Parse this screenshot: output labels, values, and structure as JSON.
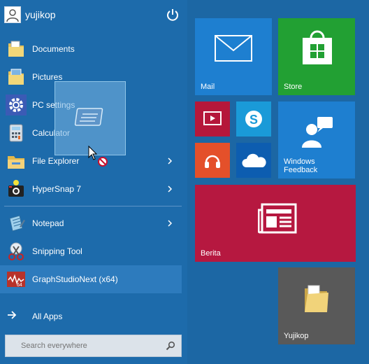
{
  "user": {
    "name": "yujikop",
    "avatar_icon": "user-avatar-icon",
    "power_icon": "power-icon"
  },
  "list": {
    "documents": "Documents",
    "pictures": "Pictures",
    "pc_settings": "PC settings",
    "calculator": "Calculator",
    "file_explorer": "File Explorer",
    "hypersnap": "HyperSnap 7",
    "notepad": "Notepad",
    "snipping_tool": "Snipping Tool",
    "graphstudio": "GraphStudioNext (x64)"
  },
  "all_apps": "All Apps",
  "search": {
    "placeholder": "Search everywhere"
  },
  "tiles": {
    "mail": "Mail",
    "store": "Store",
    "windows_feedback": "Windows\nFeedback",
    "berita": "Berita",
    "yujikop": "Yujikop"
  },
  "colors": {
    "mail": "#1e7fd0",
    "store": "#22a033",
    "video": "#b5173a",
    "skype": "#1a9ad8",
    "feedback": "#1e7fd0",
    "music": "#e4502a",
    "onedrive": "#0d5db0",
    "berita": "#b61840",
    "yujikop": "#595959"
  }
}
